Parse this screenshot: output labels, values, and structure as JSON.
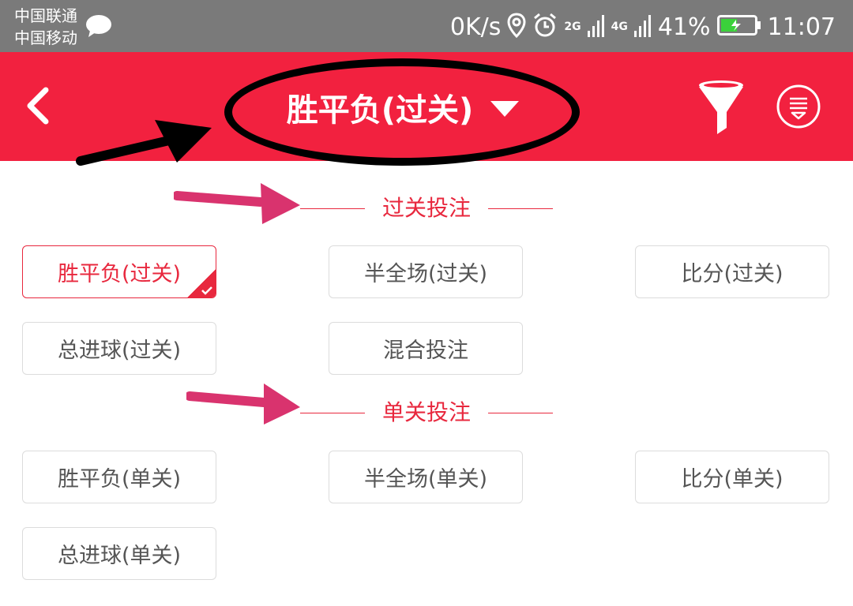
{
  "status_bar": {
    "carrier_1": "中国联通",
    "carrier_2": "中国移动",
    "network_speed": "0K/s",
    "signal_1_label": "2G",
    "signal_2_label": "4G",
    "battery": "41%",
    "time": "11:07"
  },
  "header": {
    "title": "胜平负(过关)",
    "background_color": "#f2213f",
    "icons": [
      "back-icon",
      "dropdown-caret-icon",
      "filter-icon",
      "menu-icon"
    ]
  },
  "sections": [
    {
      "title": "过关投注",
      "options": [
        {
          "label": "胜平负(过关)",
          "selected": true
        },
        {
          "label": "半全场(过关)",
          "selected": false
        },
        {
          "label": "比分(过关)",
          "selected": false
        },
        {
          "label": "总进球(过关)",
          "selected": false
        },
        {
          "label": "混合投注",
          "selected": false
        }
      ]
    },
    {
      "title": "单关投注",
      "options": [
        {
          "label": "胜平负(单关)",
          "selected": false
        },
        {
          "label": "半全场(单关)",
          "selected": false
        },
        {
          "label": "比分(单关)",
          "selected": false
        },
        {
          "label": "总进球(单关)",
          "selected": false
        }
      ]
    }
  ],
  "colors": {
    "accent": "#e8283e",
    "annotation_black": "#000000",
    "annotation_pink": "#d9336e"
  }
}
